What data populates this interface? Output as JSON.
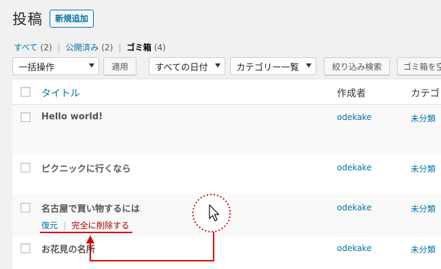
{
  "header": {
    "title": "投稿",
    "add_new": "新規追加"
  },
  "views": [
    {
      "label": "すべて",
      "count": "(2)"
    },
    {
      "label": "公開済み",
      "count": "(2)"
    },
    {
      "label": "ゴミ箱",
      "count": "(4)"
    }
  ],
  "views_separator": "|",
  "tablenav": {
    "bulk_action": "一括操作",
    "apply": "適用",
    "all_dates": "すべての日付",
    "category": "カテゴリー一覧",
    "filter": "絞り込み検索",
    "empty_trash": "ゴミ箱を空"
  },
  "columns": {
    "title": "タイトル",
    "author": "作成者",
    "category": "カテゴ"
  },
  "rows": [
    {
      "title": "Hello world!",
      "author": "odekake",
      "category": "未分類"
    },
    {
      "title": "ピクニックに行くなら",
      "author": "odekake",
      "category": "未分類"
    },
    {
      "title": "名古屋で買い物するには",
      "author": "odekake",
      "category": "未分類"
    },
    {
      "title": "お花見の名所",
      "author": "odekake",
      "category": "未分類"
    }
  ],
  "row_actions": {
    "restore": "復元",
    "separator": "|",
    "delete": "完全に削除する"
  },
  "colors": {
    "link": "#0073aa",
    "delete": "#aa0000",
    "annotation": "#e00000"
  },
  "icons": {
    "cursor": "mouse-pointer-icon"
  }
}
